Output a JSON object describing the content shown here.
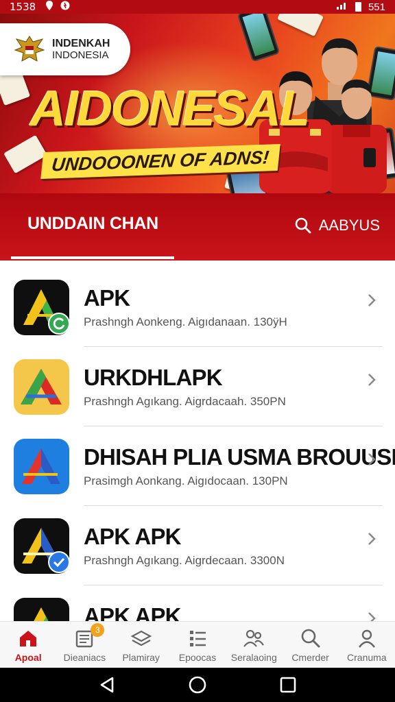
{
  "status_bar": {
    "time": "1538",
    "battery": "551"
  },
  "banner": {
    "org_line1": "INDENKAH",
    "org_line2": "INDONESIA",
    "title": "AIDONESAL",
    "subtitle": "UNDOOONEN OF ADNS!"
  },
  "tabs": {
    "active_label": "UNDDAIN CHAN",
    "search_label": "AABYUS"
  },
  "apps": [
    {
      "title": "APK",
      "subtitle": "Prashngh Aonkeng. Aigıdanaan. 130ÿH",
      "icon": "green-a-icon-with-refresh-badge"
    },
    {
      "title": "URKDHLAPK",
      "subtitle": "Prashngh Agıkang. Aigrdacaah. 350PN",
      "icon": "yellow-red-a-icon"
    },
    {
      "title": "DHISAH PLIA USMA BROUUSIN",
      "subtitle": "Prasimgh Aonkang. Aigıdocaan. 130PN",
      "icon": "blue-red-a-icon"
    },
    {
      "title": "APK APK",
      "subtitle": "Prashngh Agıkang. Aigrdecaan. 3300N",
      "icon": "yellow-a-icon-with-check-badge"
    },
    {
      "title": "APK APK",
      "subtitle": "",
      "icon": "green-a-icon"
    }
  ],
  "bottom_nav": [
    {
      "label": "Apoal",
      "icon": "home-icon",
      "active": true
    },
    {
      "label": "Dieaniacs",
      "icon": "clipboard-icon",
      "badge": "3"
    },
    {
      "label": "Plamiray",
      "icon": "layers-icon"
    },
    {
      "label": "Epoocas",
      "icon": "list-icon"
    },
    {
      "label": "Seralaoing",
      "icon": "people-icon"
    },
    {
      "label": "Cmerder",
      "icon": "search-icon"
    },
    {
      "label": "Cranuma",
      "icon": "profile-icon"
    }
  ],
  "colors": {
    "brand_red": "#c8141a",
    "accent_yellow": "#ffd93a",
    "badge_orange": "#f2a21c"
  }
}
